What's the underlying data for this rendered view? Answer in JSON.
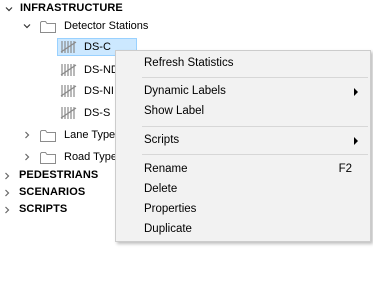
{
  "tree": {
    "infrastructure": "INFRASTRUCTURE",
    "detector_stations": "Detector Stations",
    "stations": [
      "DS-C",
      "DS-ND",
      "DS-NI",
      "DS-S"
    ],
    "lane_types": "Lane Types",
    "road_types": "Road Types",
    "pedestrians": "PEDESTRIANS",
    "scenarios": "SCENARIOS",
    "scripts": "SCRIPTS",
    "selected": "DS-C"
  },
  "context_menu": {
    "refresh_statistics": "Refresh Statistics",
    "dynamic_labels": "Dynamic Labels",
    "show_label": "Show Label",
    "scripts": "Scripts",
    "rename": "Rename",
    "rename_shortcut": "F2",
    "delete": "Delete",
    "properties": "Properties",
    "duplicate": "Duplicate"
  },
  "colors": {
    "selection_fill": "#cce8ff",
    "selection_border": "#99d1ff",
    "menu_background": "#f2f2f2",
    "folder_fill": "#ffffff",
    "folder_stroke": "#8c8c8c"
  },
  "icons": {
    "expanded": "chevron-down-icon",
    "collapsed": "chevron-right-icon",
    "folder": "folder-icon",
    "detector": "detector-station-icon",
    "submenu": "submenu-arrow-icon"
  }
}
